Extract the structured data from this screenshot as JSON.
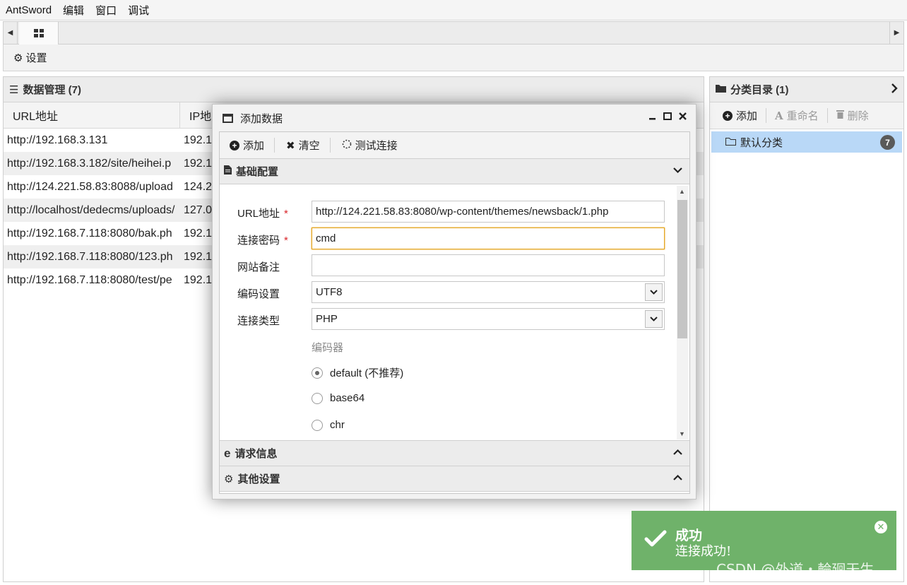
{
  "menu": [
    "AntSword",
    "编辑",
    "窗口",
    "调试"
  ],
  "tabs": {
    "left_arrow": "◀",
    "right_arrow": "▶"
  },
  "top_toolbar": {
    "settings_label": "设置"
  },
  "data_panel": {
    "title": "数据管理 (7)",
    "columns": [
      "URL地址",
      "IP地"
    ],
    "rows": [
      {
        "url": "http://192.168.3.131",
        "ip": "192.1"
      },
      {
        "url": "http://192.168.3.182/site/heihei.p",
        "ip": "192.1"
      },
      {
        "url": "http://124.221.58.83:8088/upload",
        "ip": "124.2"
      },
      {
        "url": "http://localhost/dedecms/uploads/",
        "ip": "127.0"
      },
      {
        "url": "http://192.168.7.118:8080/bak.ph",
        "ip": "192.1"
      },
      {
        "url": "http://192.168.7.118:8080/123.ph",
        "ip": "192.1"
      },
      {
        "url": "http://192.168.7.118:8080/test/pe",
        "ip": "192.1"
      }
    ]
  },
  "category_panel": {
    "title": "分类目录 (1)",
    "add_label": "添加",
    "rename_label": "重命名",
    "delete_label": "删除",
    "items": [
      {
        "label": "默认分类",
        "count": "7"
      }
    ]
  },
  "dialog": {
    "title": "添加数据",
    "toolbar": {
      "add": "添加",
      "clear": "清空",
      "test": "测试连接"
    },
    "sections": {
      "basic": "基础配置",
      "request": "请求信息",
      "other": "其他设置"
    },
    "fields": {
      "url_label": "URL地址",
      "url_value": "http://124.221.58.83:8080/wp-content/themes/newsback/1.php",
      "password_label": "连接密码",
      "password_value": "cmd",
      "note_label": "网站备注",
      "note_value": "",
      "encoding_label": "编码设置",
      "encoding_value": "UTF8",
      "type_label": "连接类型",
      "type_value": "PHP",
      "required_mark": "*"
    },
    "encoder": {
      "label": "编码器",
      "options": [
        {
          "label": "default (不推荐)",
          "checked": true
        },
        {
          "label": "base64",
          "checked": false
        },
        {
          "label": "chr",
          "checked": false
        }
      ]
    }
  },
  "toast": {
    "title": "成功",
    "message": "连接成功!"
  },
  "watermark": "CSDN @外道・輪廻天生",
  "colors": {
    "toast_bg": "#6fb26a",
    "selected_category": "#b9d8f7",
    "focus_border": "#e3a21a",
    "required": "#d9252a"
  }
}
